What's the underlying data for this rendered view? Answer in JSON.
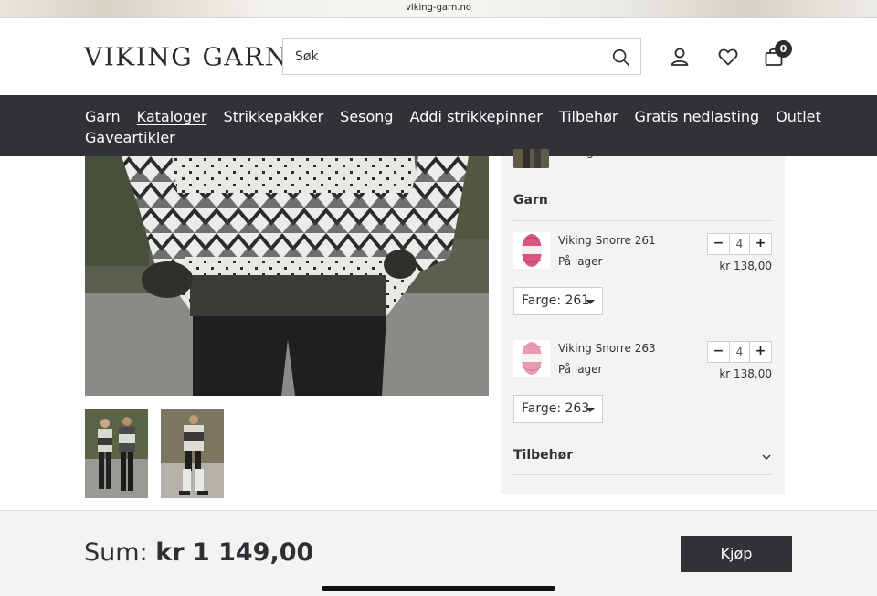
{
  "browser": {
    "url": "viking-garn.no"
  },
  "header": {
    "logo": "VIKING GARN",
    "search_placeholder": "Søk",
    "cart_count": "0",
    "icons": [
      "search-icon",
      "user-icon",
      "heart-icon",
      "bag-icon"
    ]
  },
  "nav": {
    "items": [
      {
        "label": "Garn"
      },
      {
        "label": "Kataloger",
        "active": true
      },
      {
        "label": "Strikkepakker"
      },
      {
        "label": "Sesong"
      },
      {
        "label": "Addi strikkepinner"
      },
      {
        "label": "Tilbehør"
      },
      {
        "label": "Gratis nedlasting"
      },
      {
        "label": "Outlet"
      },
      {
        "label": "Gaveartikler"
      }
    ]
  },
  "panel": {
    "top_item_stock": "På lager",
    "garn_title": "Garn",
    "yarns": [
      {
        "name": "Viking Snorre 261",
        "stock": "På lager",
        "qty": "4",
        "price": "kr 138,00",
        "color_select": "Farge: 261",
        "swatch": "#d9577f",
        "minus": "−",
        "plus": "+"
      },
      {
        "name": "Viking Snorre 263",
        "stock": "På lager",
        "qty": "4",
        "price": "kr 138,00",
        "color_select": "Farge: 263",
        "swatch": "#e89aae",
        "minus": "−",
        "plus": "+"
      }
    ],
    "accessories_title": "Tilbehør"
  },
  "footer": {
    "sum_label": "Sum:",
    "sum_value": "kr 1 149,00",
    "buy_label": "Kjøp"
  },
  "colors": {
    "dark": "#313136",
    "panel_bg": "#f3f3f3",
    "accent_pink": "#d9577f"
  }
}
